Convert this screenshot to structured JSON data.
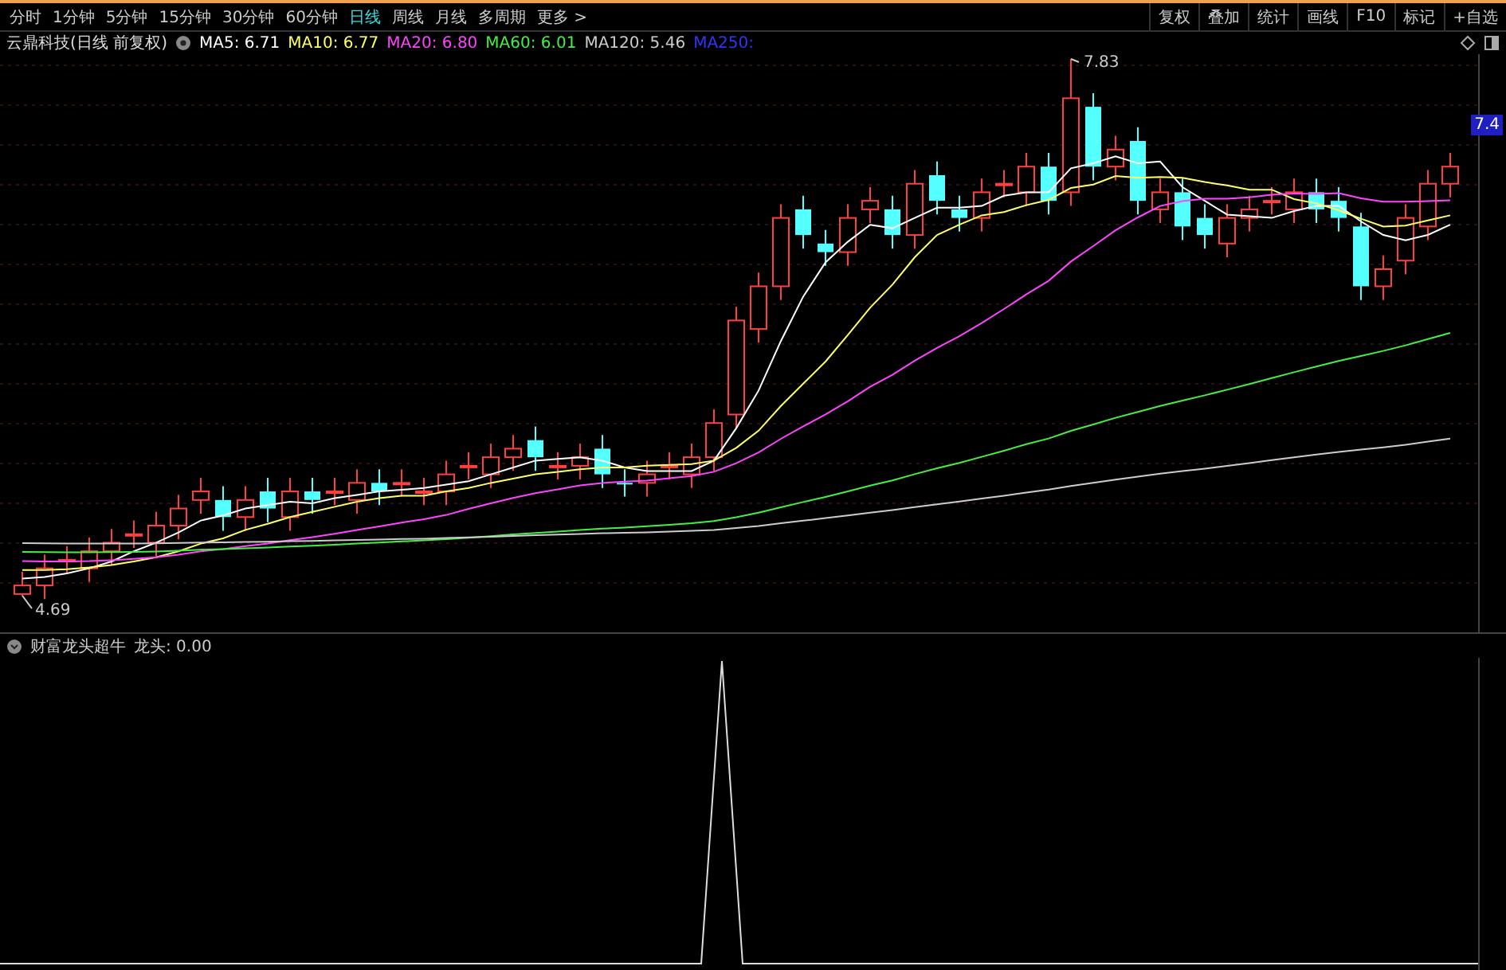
{
  "toolbar": {
    "periods": [
      {
        "label": "分时",
        "selected": false
      },
      {
        "label": "1分钟",
        "selected": false
      },
      {
        "label": "5分钟",
        "selected": false
      },
      {
        "label": "15分钟",
        "selected": false
      },
      {
        "label": "30分钟",
        "selected": false
      },
      {
        "label": "60分钟",
        "selected": false
      },
      {
        "label": "日线",
        "selected": true
      },
      {
        "label": "周线",
        "selected": false
      },
      {
        "label": "月线",
        "selected": false
      },
      {
        "label": "多周期",
        "selected": false
      },
      {
        "label": "更多 >",
        "selected": false
      }
    ],
    "tools": [
      "复权",
      "叠加",
      "统计",
      "画线",
      "F10",
      "标记",
      "+自选"
    ]
  },
  "chart": {
    "title": "云鼎科技(日线 前复权)",
    "moving_averages": [
      {
        "label": "MA5: 6.71",
        "color": "#ffffff"
      },
      {
        "label": "MA10: 6.77",
        "color": "#ffff66"
      },
      {
        "label": "MA20: 6.80",
        "color": "#ff44ff"
      },
      {
        "label": "MA60: 6.01",
        "color": "#44ee44"
      },
      {
        "label": "MA120: 5.46",
        "color": "#cccccc"
      },
      {
        "label": "MA250:",
        "color": "#3333ff"
      }
    ],
    "high_label": "7.83",
    "low_label": "4.69",
    "price_tag": "7.4"
  },
  "indicator": {
    "name": "财富龙头超牛",
    "value": "龙头: 0.00"
  }
}
